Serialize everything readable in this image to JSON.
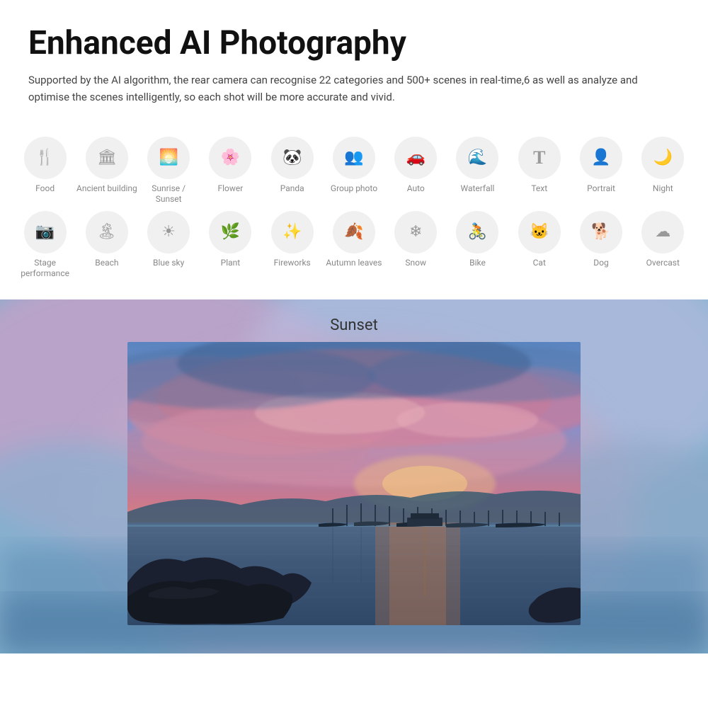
{
  "header": {
    "title": "Enhanced AI Photography",
    "description": "Supported by the AI algorithm, the rear camera can recognise 22 categories and 500+ scenes in real-time,6 as well as analyze and optimise the scenes intelligently, so each shot will be more accurate and vivid."
  },
  "categories_row1": [
    {
      "id": "food",
      "label": "Food",
      "icon": "food"
    },
    {
      "id": "ancient-building",
      "label": "Ancient building",
      "icon": "ancient"
    },
    {
      "id": "sunrise-sunset",
      "label": "Sunrise / Sunset",
      "icon": "sunrise"
    },
    {
      "id": "flower",
      "label": "Flower",
      "icon": "flower"
    },
    {
      "id": "panda",
      "label": "Panda",
      "icon": "panda"
    },
    {
      "id": "group-photo",
      "label": "Group photo",
      "icon": "group"
    },
    {
      "id": "auto",
      "label": "Auto",
      "icon": "auto"
    },
    {
      "id": "waterfall",
      "label": "Waterfall",
      "icon": "waterfall"
    },
    {
      "id": "text",
      "label": "Text",
      "icon": "text"
    },
    {
      "id": "portrait",
      "label": "Portrait",
      "icon": "portrait"
    },
    {
      "id": "night",
      "label": "Night",
      "icon": "night"
    }
  ],
  "categories_row2": [
    {
      "id": "stage-performance",
      "label": "Stage performance",
      "icon": "stage"
    },
    {
      "id": "beach",
      "label": "Beach",
      "icon": "beach"
    },
    {
      "id": "blue-sky",
      "label": "Blue sky",
      "icon": "bluesky"
    },
    {
      "id": "plant",
      "label": "Plant",
      "icon": "plant"
    },
    {
      "id": "fireworks",
      "label": "Fireworks",
      "icon": "fireworks"
    },
    {
      "id": "autumn-leaves",
      "label": "Autumn leaves",
      "icon": "autumn"
    },
    {
      "id": "snow",
      "label": "Snow",
      "icon": "snow"
    },
    {
      "id": "bike",
      "label": "Bike",
      "icon": "bike"
    },
    {
      "id": "cat",
      "label": "Cat",
      "icon": "cat"
    },
    {
      "id": "dog",
      "label": "Dog",
      "icon": "dog"
    },
    {
      "id": "overcast",
      "label": "Overcast",
      "icon": "overcast"
    }
  ],
  "photo": {
    "label": "Sunset"
  }
}
